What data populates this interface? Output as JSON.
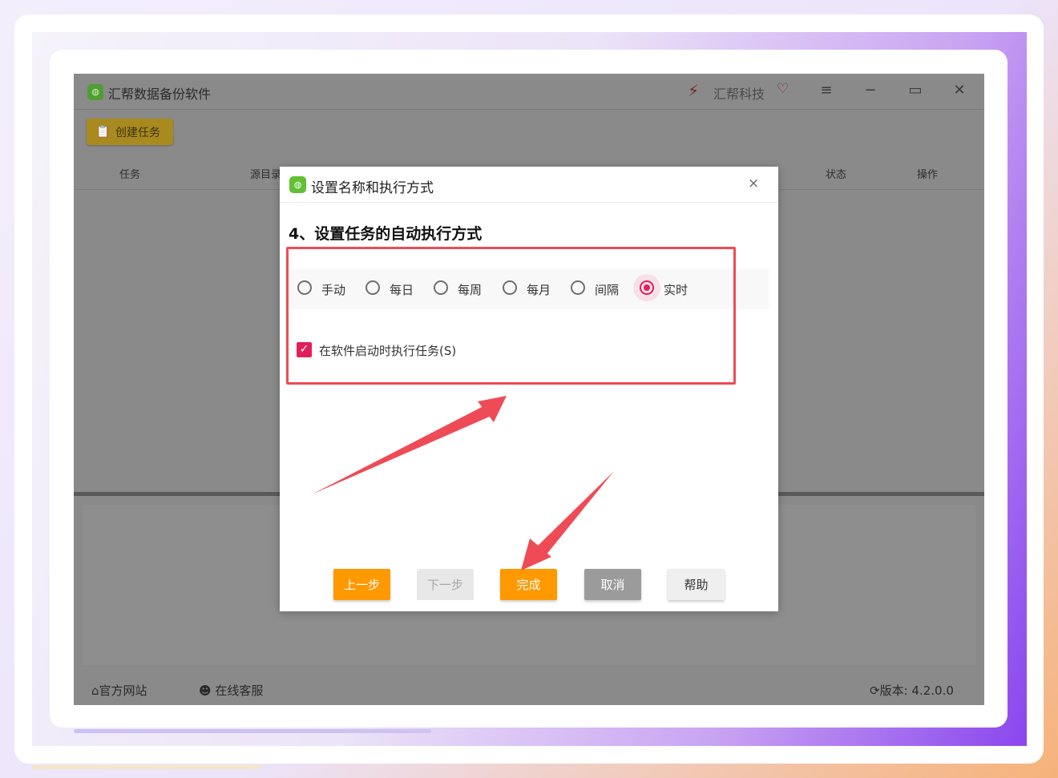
{
  "app": {
    "title": "汇帮数据备份软件",
    "logo_glyph": "◍",
    "brand_name": "汇帮科技",
    "window_controls": {
      "menu": "≡",
      "minimize": "−",
      "maximize": "▭",
      "close": "✕"
    }
  },
  "toolbar": {
    "create_task_label": "创建任务",
    "create_task_icon": "📋"
  },
  "table": {
    "columns": [
      "任务",
      "源目录",
      "状态",
      "操作"
    ],
    "rows": []
  },
  "footer": {
    "website_label": "官方网站",
    "support_label": "在线客服",
    "version_label": "版本: 4.2.0.0"
  },
  "dialog": {
    "title": "设置名称和执行方式",
    "close_label": "×",
    "step_title": "4、设置任务的自动执行方式",
    "schedule_options": [
      {
        "label": "手动",
        "selected": false
      },
      {
        "label": "每日",
        "selected": false
      },
      {
        "label": "每周",
        "selected": false
      },
      {
        "label": "每月",
        "selected": false
      },
      {
        "label": "间隔",
        "selected": false
      },
      {
        "label": "实时",
        "selected": true
      }
    ],
    "run_on_startup": {
      "label": "在软件启动时执行任务(S)",
      "checked": true
    },
    "buttons": {
      "prev": "上一步",
      "next": "下一步",
      "finish": "完成",
      "cancel": "取消",
      "help": "帮助"
    }
  },
  "colors": {
    "accent": "#e0205a",
    "primary_button": "#ff9900",
    "highlight_box": "#ef4b57"
  }
}
